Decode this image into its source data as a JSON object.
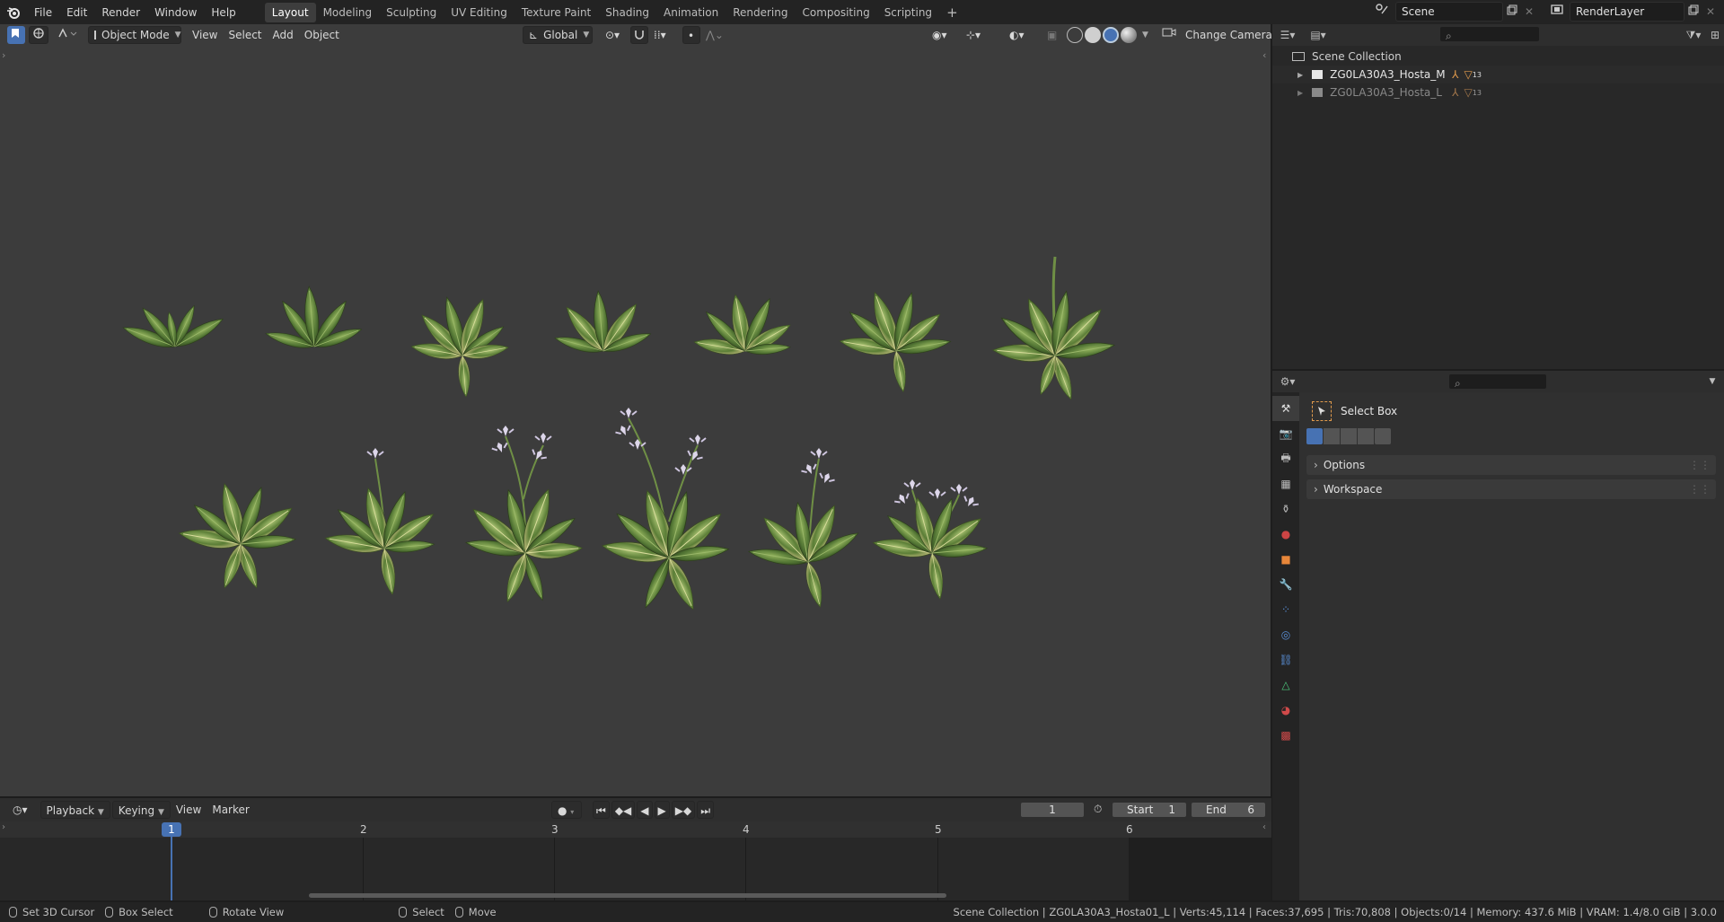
{
  "topbar": {
    "menus": [
      "File",
      "Edit",
      "Render",
      "Window",
      "Help"
    ],
    "workspaces": [
      "Layout",
      "Modeling",
      "Sculpting",
      "UV Editing",
      "Texture Paint",
      "Shading",
      "Animation",
      "Rendering",
      "Compositing",
      "Scripting"
    ],
    "active_workspace": "Layout",
    "add_workspace": "+",
    "scene_name": "Scene",
    "view_layer": "RenderLayer"
  },
  "viewport": {
    "mode": "Object Mode",
    "menus": [
      "View",
      "Select",
      "Add",
      "Object"
    ],
    "transform_orientation": "Global",
    "change_camera": "Change Camera",
    "background": "#3c3c3c"
  },
  "outliner": {
    "root": "Scene Collection",
    "items": [
      {
        "name": "ZG0LA30A3_Hosta_M",
        "count": "13",
        "dimmed": false
      },
      {
        "name": "ZG0LA30A3_Hosta_L",
        "count": "13",
        "dimmed": true
      }
    ]
  },
  "properties": {
    "tool_name": "Select Box",
    "panels": [
      "Options",
      "Workspace"
    ]
  },
  "timeline": {
    "menus": [
      "Playback",
      "Keying",
      "View",
      "Marker"
    ],
    "current_frame": "1",
    "start_label": "Start",
    "start": "1",
    "end_label": "End",
    "end": "6",
    "frame_markers": [
      "1",
      "2",
      "3",
      "4",
      "5",
      "6"
    ]
  },
  "statusbar": {
    "hints": [
      "Set 3D Cursor",
      "Box Select",
      "Rotate View",
      "Select",
      "Move"
    ],
    "stats": "Scene Collection | ZG0LA30A3_Hosta01_L | Verts:45,114 | Faces:37,695 | Tris:70,808 | Objects:0/14 | Memory: 437.6 MiB | VRAM: 1.4/8.0 GiB | 3.0.0"
  },
  "colors": {
    "accent_blue": "#4772b3",
    "plant_green": "#5b7a3a",
    "flower_lilac": "#d9d2e6"
  }
}
